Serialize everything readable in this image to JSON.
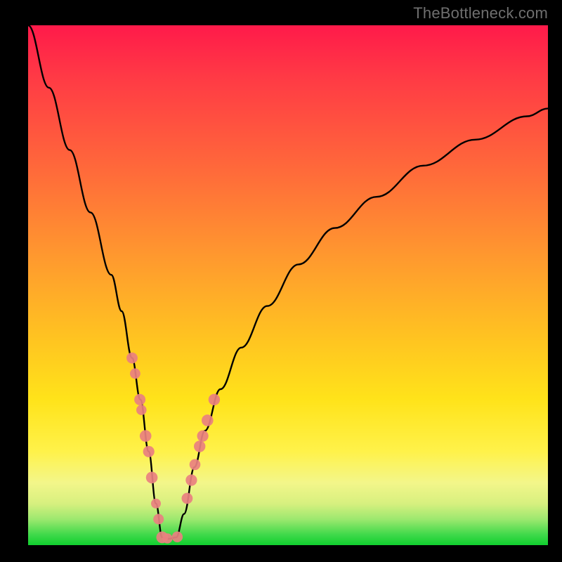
{
  "watermark": "TheBottleneck.com",
  "colors": {
    "frame": "#000000",
    "watermark": "#6f6f6f",
    "curve": "#000000",
    "marker_fill": "#e98080",
    "gradient_top": "#ff1a4a",
    "gradient_bottom": "#10cf2e"
  },
  "chart_data": {
    "type": "line",
    "title": "",
    "xlabel": "",
    "ylabel": "",
    "xlim": [
      0,
      100
    ],
    "ylim": [
      0,
      100
    ],
    "grid": false,
    "legend": false,
    "series": [
      {
        "name": "bottleneck-curve",
        "x": [
          0,
          4,
          8,
          12,
          16,
          18,
          20,
          21.6,
          23.2,
          24.6,
          25.8,
          27,
          28.5,
          30,
          32,
          34,
          37,
          41,
          46,
          52,
          59,
          67,
          76,
          86,
          96,
          100
        ],
        "values": [
          100,
          88,
          76,
          64,
          52,
          45,
          36,
          28,
          18,
          8,
          1.5,
          1.2,
          1.5,
          6,
          15,
          22,
          30,
          38,
          46,
          54,
          61,
          67,
          73,
          78,
          82.5,
          84
        ]
      }
    ],
    "markers": {
      "name": "highlighted-points",
      "x": [
        20.0,
        20.6,
        21.5,
        21.8,
        22.6,
        23.2,
        23.8,
        24.6,
        25.1,
        25.8,
        26.8,
        28.7,
        30.6,
        31.4,
        32.1,
        33.0,
        33.6,
        34.5,
        35.8
      ],
      "values": [
        36,
        33,
        28,
        26,
        21,
        18,
        13,
        8,
        5,
        1.5,
        1.3,
        1.6,
        9,
        12.5,
        15.5,
        19,
        21,
        24,
        28
      ]
    },
    "background_gradient": {
      "orientation": "vertical",
      "stops": [
        {
          "pos": 0.0,
          "color": "#ff1a4a"
        },
        {
          "pos": 0.45,
          "color": "#ff9a2e"
        },
        {
          "pos": 0.72,
          "color": "#ffe31a"
        },
        {
          "pos": 0.92,
          "color": "#d7f07f"
        },
        {
          "pos": 1.0,
          "color": "#10cf2e"
        }
      ]
    }
  }
}
